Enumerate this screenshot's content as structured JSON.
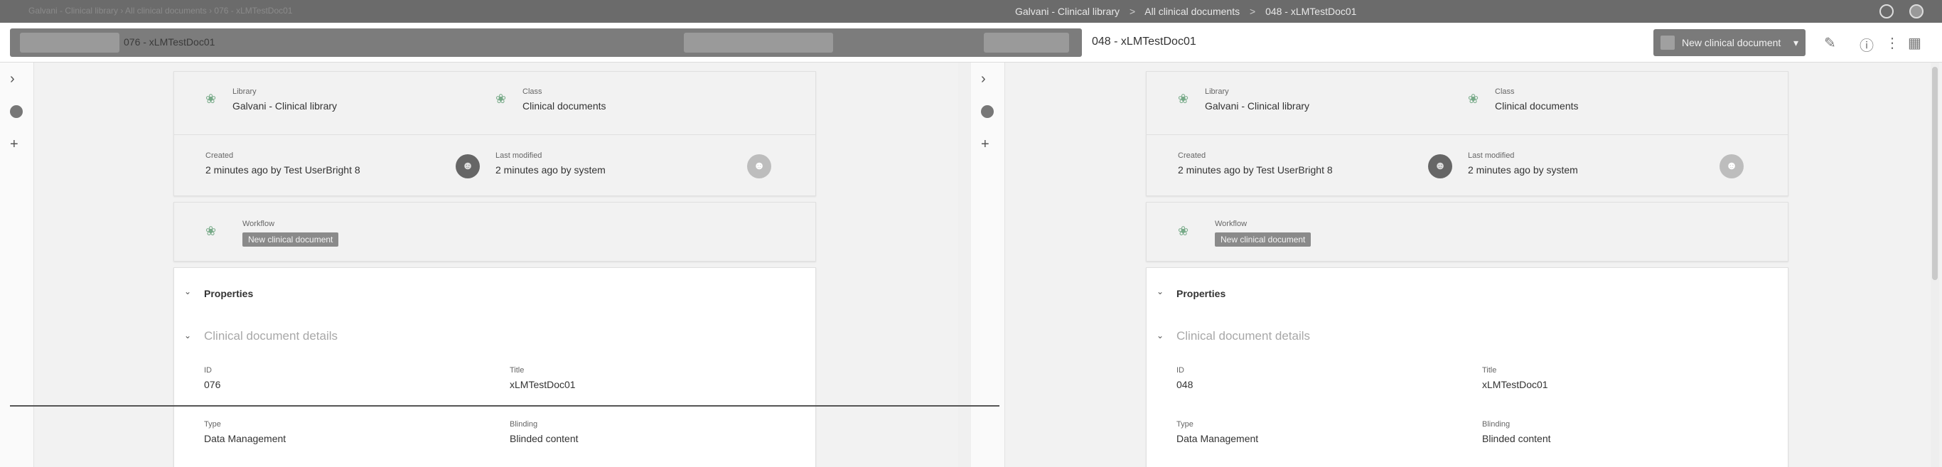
{
  "topbar": {
    "breadcrumbs": [
      "Galvani - Clinical library",
      "All clinical documents",
      "048 - xLMTestDoc01"
    ],
    "separator": ">",
    "faded_text": "Galvani - Clinical library › All clinical documents › 076 - xLMTestDoc01",
    "right_icons": [
      "help-icon",
      "user-icon"
    ]
  },
  "toolbar": {
    "left_doc_title": "076 - xLMTestDoc01",
    "doc_title": "048 - xLMTestDoc01",
    "new_doc_button": "New clinical document",
    "tool_icons": [
      "pencil-icon",
      "info-icon",
      "more-icon",
      "calendar-icon"
    ]
  },
  "strip": {
    "icons": [
      "chevron-right-icon",
      "collapse-dot-icon",
      "plus-icon"
    ]
  },
  "panes": [
    {
      "library_label": "Library",
      "library_value": "Galvani - Clinical library",
      "class_label": "Class",
      "class_value": "Clinical documents",
      "created_label": "Created",
      "created_value": "2 minutes ago by Test UserBright 8",
      "modified_label": "Last modified",
      "modified_value": "2 minutes ago by system",
      "workflow_label": "Workflow",
      "workflow_value": "New clinical document",
      "properties_label": "Properties",
      "details_label": "Clinical document details",
      "id_label": "ID",
      "id_value": "076",
      "title_label": "Title",
      "title_value": "xLMTestDoc01",
      "type_label": "Type",
      "type_value": "Data Management",
      "blinding_label": "Blinding",
      "blinding_value": "Blinded content"
    },
    {
      "library_label": "Library",
      "library_value": "Galvani - Clinical library",
      "class_label": "Class",
      "class_value": "Clinical documents",
      "created_label": "Created",
      "created_value": "2 minutes ago by Test UserBright 8",
      "modified_label": "Last modified",
      "modified_value": "2 minutes ago by system",
      "workflow_label": "Workflow",
      "workflow_value": "New clinical document",
      "properties_label": "Properties",
      "details_label": "Clinical document details",
      "id_label": "ID",
      "id_value": "048",
      "title_label": "Title",
      "title_value": "xLMTestDoc01",
      "type_label": "Type",
      "type_value": "Data Management",
      "blinding_label": "Blinding",
      "blinding_value": "Blinded content"
    }
  ],
  "colors": {
    "topbar": "#6b6b6b",
    "button": "#7a7a7a",
    "page": "#f2f2f2"
  }
}
